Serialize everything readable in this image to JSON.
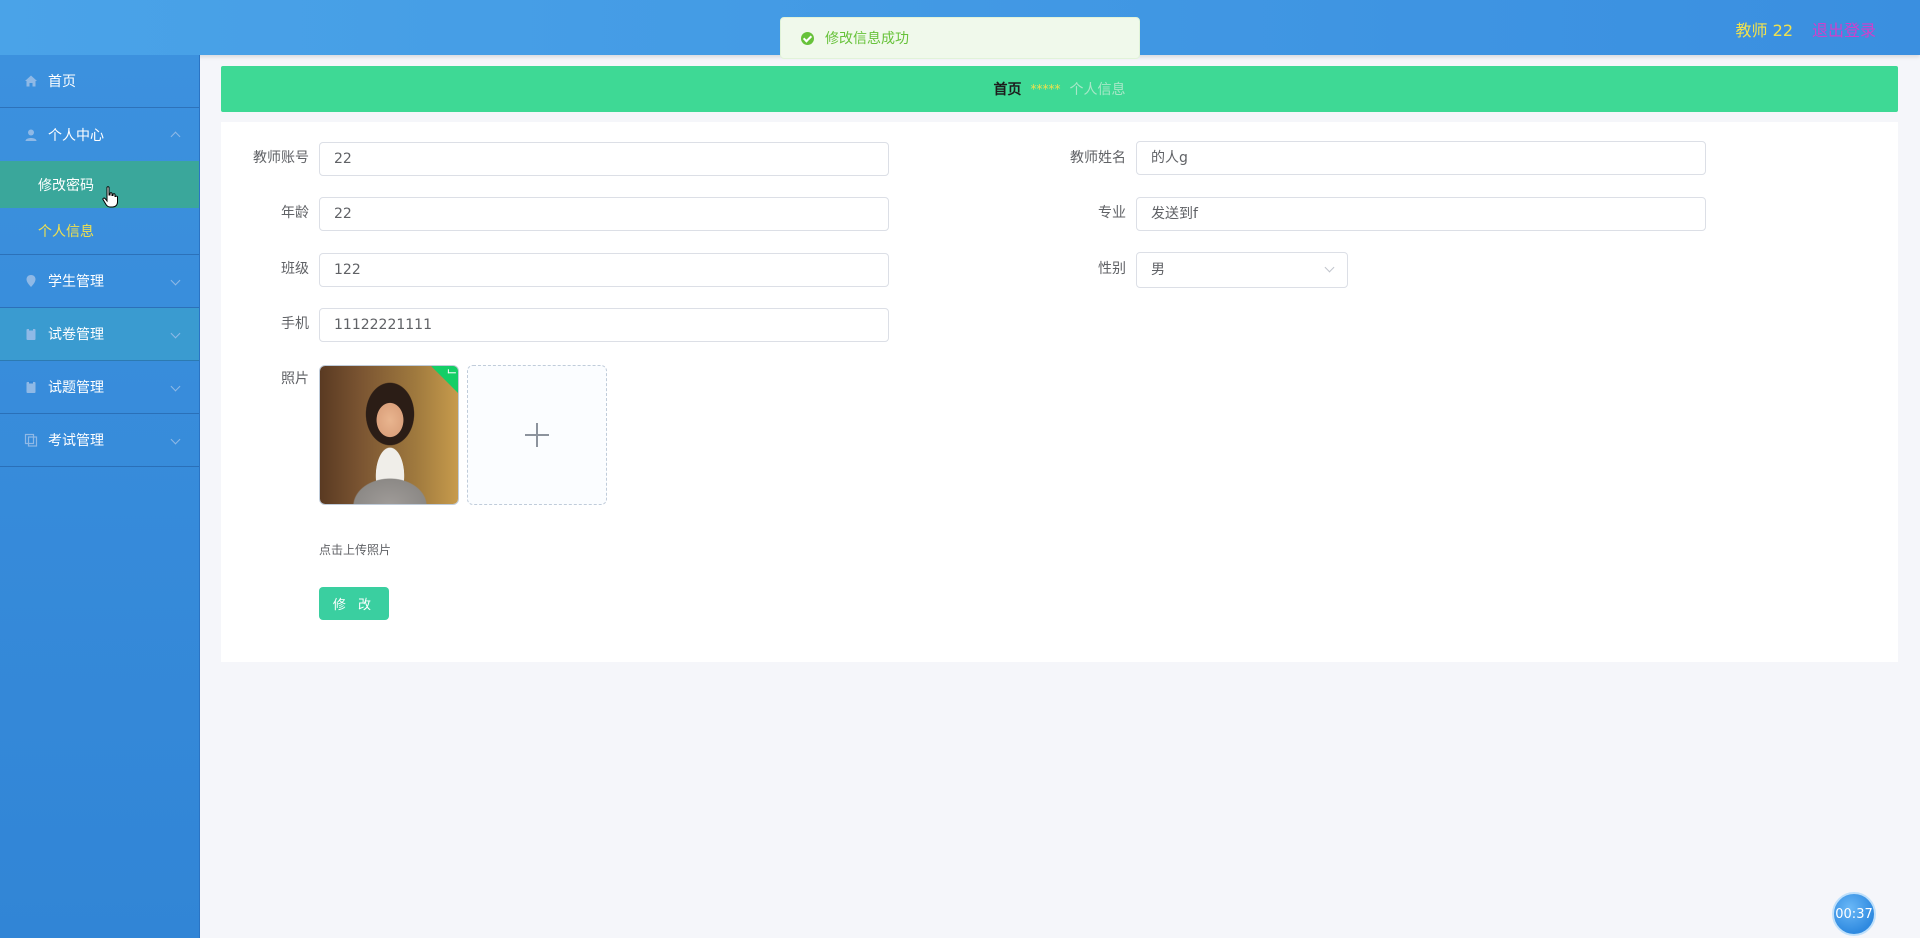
{
  "header": {
    "user_label": "教师 22",
    "logout_label": "退出登录"
  },
  "toast": {
    "message": "修改信息成功"
  },
  "sidebar": {
    "items": [
      {
        "label": "首页"
      },
      {
        "label": "个人中心",
        "children": [
          {
            "label": "修改密码"
          },
          {
            "label": "个人信息"
          }
        ]
      },
      {
        "label": "学生管理"
      },
      {
        "label": "试卷管理"
      },
      {
        "label": "试题管理"
      },
      {
        "label": "考试管理"
      }
    ]
  },
  "breadcrumb": {
    "home": "首页",
    "separator": "*****",
    "current": "个人信息"
  },
  "form": {
    "account_label": "教师账号",
    "account_value": "22",
    "name_label": "教师姓名",
    "name_value": "的人g",
    "age_label": "年龄",
    "age_value": "22",
    "major_label": "专业",
    "major_value": "发送到f",
    "class_label": "班级",
    "class_value": "122",
    "gender_label": "性别",
    "gender_value": "男",
    "phone_label": "手机",
    "phone_value": "11122221111",
    "photo_label": "照片",
    "upload_tip": "点击上传照片",
    "submit_label": "修 改"
  },
  "timer": {
    "value": "00:37"
  },
  "colors": {
    "topbar": "#3a8fe0",
    "accent_green": "#3ed995",
    "button": "#3acfa0",
    "user_text": "#f1e14d",
    "logout_text": "#d13fcb"
  }
}
